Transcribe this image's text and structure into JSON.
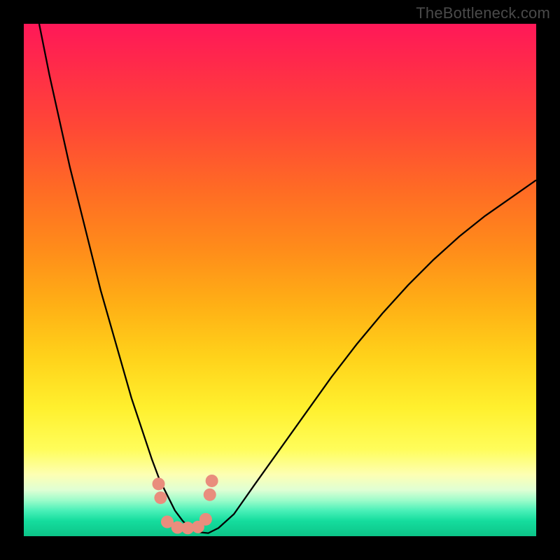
{
  "watermark": "TheBottleneck.com",
  "chart_data": {
    "type": "line",
    "title": "",
    "xlabel": "",
    "ylabel": "",
    "xlim": [
      0,
      100
    ],
    "ylim": [
      0,
      100
    ],
    "series": [
      {
        "name": "bottleneck-curve",
        "x": [
          3,
          5,
          7,
          9,
          11,
          13,
          15,
          17,
          19,
          21,
          23,
          25,
          26.5,
          28,
          29.5,
          31,
          32.5,
          34,
          36,
          38,
          41,
          45,
          50,
          55,
          60,
          65,
          70,
          75,
          80,
          85,
          90,
          95,
          100
        ],
        "values": [
          100,
          90,
          81,
          72,
          64,
          56,
          48,
          41,
          34,
          27,
          21,
          15,
          11,
          8,
          5,
          3,
          1.5,
          0.8,
          0.6,
          1.6,
          4.3,
          10,
          17,
          24,
          31,
          37.5,
          43.5,
          49,
          54,
          58.5,
          62.5,
          66,
          69.5
        ]
      },
      {
        "name": "marker-points",
        "x": [
          26.3,
          26.7,
          28,
          30,
          32,
          34,
          35.5,
          36.3,
          36.7
        ],
        "values": [
          10.2,
          7.5,
          2.8,
          1.7,
          1.6,
          1.8,
          3.3,
          8.1,
          10.8
        ]
      }
    ],
    "marker_color": "#e98d7d",
    "curve_color": "#000000"
  }
}
